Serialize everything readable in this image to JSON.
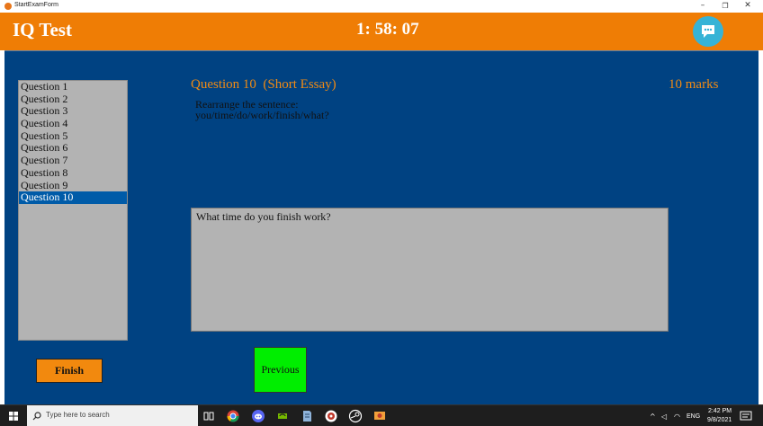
{
  "window": {
    "title": "StartExamForm",
    "minimize_glyph": "–",
    "maximize_glyph": "❐",
    "close_glyph": "✕"
  },
  "header": {
    "app_name": "IQ Test",
    "timer": "1: 58: 07",
    "chat_icon": "chat-bubble-icon"
  },
  "questions": {
    "items": [
      "Question 1",
      "Question 2",
      "Question 3",
      "Question 4",
      "Question 5",
      "Question 6",
      "Question 7",
      "Question 8",
      "Question 9",
      "Question 10"
    ],
    "selected_index": 9
  },
  "question": {
    "title": "Question 10  (Short Essay)",
    "marks": "10 marks",
    "text_line1": "Rearrange the sentence:",
    "text_line2": "you/time/do/work/finish/what?"
  },
  "answer": {
    "value": "What time do you finish work?"
  },
  "buttons": {
    "finish": "Finish",
    "previous": "Previous"
  },
  "taskbar": {
    "search_placeholder": "Type here to search",
    "apps": [
      "task-view-icon",
      "chrome-icon",
      "discord-icon",
      "nvidia-icon",
      "notepad-icon",
      "media-icon",
      "steam-icon",
      "app-icon"
    ],
    "language": "ENG",
    "time": "2:42 PM",
    "date": "9/8/2021"
  },
  "colors": {
    "header": "#ef7d05",
    "main_bg": "#004282",
    "accent_text": "#ef8a14",
    "finish_button": "#f2890e",
    "previous_button": "#00ee00",
    "chat_button": "#36b3d6"
  }
}
